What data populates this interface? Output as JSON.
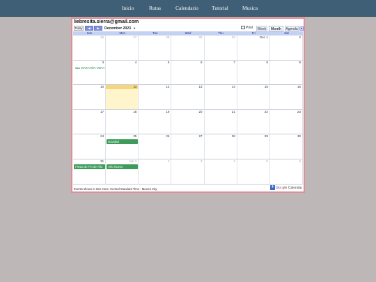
{
  "nav": {
    "items": [
      {
        "label": "Inicio"
      },
      {
        "label": "Rutas"
      },
      {
        "label": "Calendario"
      },
      {
        "label": "Tutorial"
      },
      {
        "label": "Musica"
      }
    ]
  },
  "calendar": {
    "title": "liebresita.sierra@gmail.com",
    "today_label": "Today",
    "prev_symbol": "◀",
    "next_symbol": "▶",
    "current_month": "December 2023",
    "month_caret": "▼",
    "print_label": "Print",
    "views": [
      "Week",
      "Month",
      "Agenda"
    ],
    "active_view": "Month",
    "view_dropdown_symbol": "▼",
    "weekdays": [
      "Sun",
      "Mon",
      "Tue",
      "Wed",
      "Thu",
      "Fri",
      "Sat"
    ],
    "weeks": [
      [
        {
          "n": "26",
          "o": true
        },
        {
          "n": "27",
          "o": true
        },
        {
          "n": "28",
          "o": true
        },
        {
          "n": "29",
          "o": true
        },
        {
          "n": "30",
          "o": true
        },
        {
          "n": "Dec 1",
          "o": false
        },
        {
          "n": "2",
          "o": false
        }
      ],
      [
        {
          "n": "3",
          "o": false
        },
        {
          "n": "4",
          "o": false
        },
        {
          "n": "5",
          "o": false
        },
        {
          "n": "6",
          "o": false
        },
        {
          "n": "7",
          "o": false
        },
        {
          "n": "8",
          "o": false
        },
        {
          "n": "9",
          "o": false
        }
      ],
      [
        {
          "n": "10",
          "o": false
        },
        {
          "n": "11",
          "o": false
        },
        {
          "n": "12",
          "o": false
        },
        {
          "n": "13",
          "o": false
        },
        {
          "n": "14",
          "o": false
        },
        {
          "n": "15",
          "o": false
        },
        {
          "n": "16",
          "o": false
        }
      ],
      [
        {
          "n": "17",
          "o": false
        },
        {
          "n": "18",
          "o": false
        },
        {
          "n": "19",
          "o": false
        },
        {
          "n": "20",
          "o": false
        },
        {
          "n": "21",
          "o": false
        },
        {
          "n": "22",
          "o": false
        },
        {
          "n": "23",
          "o": false
        }
      ],
      [
        {
          "n": "24",
          "o": false
        },
        {
          "n": "25",
          "o": false
        },
        {
          "n": "26",
          "o": false
        },
        {
          "n": "27",
          "o": false
        },
        {
          "n": "28",
          "o": false
        },
        {
          "n": "29",
          "o": false
        },
        {
          "n": "30",
          "o": false
        }
      ],
      [
        {
          "n": "31",
          "o": false
        },
        {
          "n": "Jan 1",
          "o": true
        },
        {
          "n": "2",
          "o": true
        },
        {
          "n": "3",
          "o": true
        },
        {
          "n": "4",
          "o": true
        },
        {
          "n": "5",
          "o": true
        },
        {
          "n": "6",
          "o": true
        }
      ]
    ],
    "today": {
      "week": 2,
      "day": 1
    },
    "events": [
      {
        "week": 1,
        "day": 0,
        "kind": "timed",
        "time": "9am",
        "label": "MARATÓN VERA"
      },
      {
        "week": 4,
        "day": 1,
        "kind": "allday",
        "label": "Navidad"
      },
      {
        "week": 5,
        "day": 0,
        "kind": "allday",
        "label": "Fiesta de Fin de Año"
      },
      {
        "week": 5,
        "day": 1,
        "kind": "allday",
        "label": "Año Nuevo"
      }
    ],
    "timezone_note": "Events shown in time zone: Central Standard Time - Mexico City",
    "badge": {
      "plus": "+",
      "g1": "G",
      "g2": "o",
      "g3": "o",
      "g4": "g",
      "g5": "l",
      "g6": "e",
      "suffix": " Calendar"
    }
  },
  "colors": {
    "nav_bg": "#3e5f75",
    "page_bg": "#bdb8b7",
    "frame_border": "#e08e9b",
    "weekday_bg": "#c3d2f2",
    "today_bg": "#fff5cc",
    "event_green": "#3e9b5a"
  }
}
